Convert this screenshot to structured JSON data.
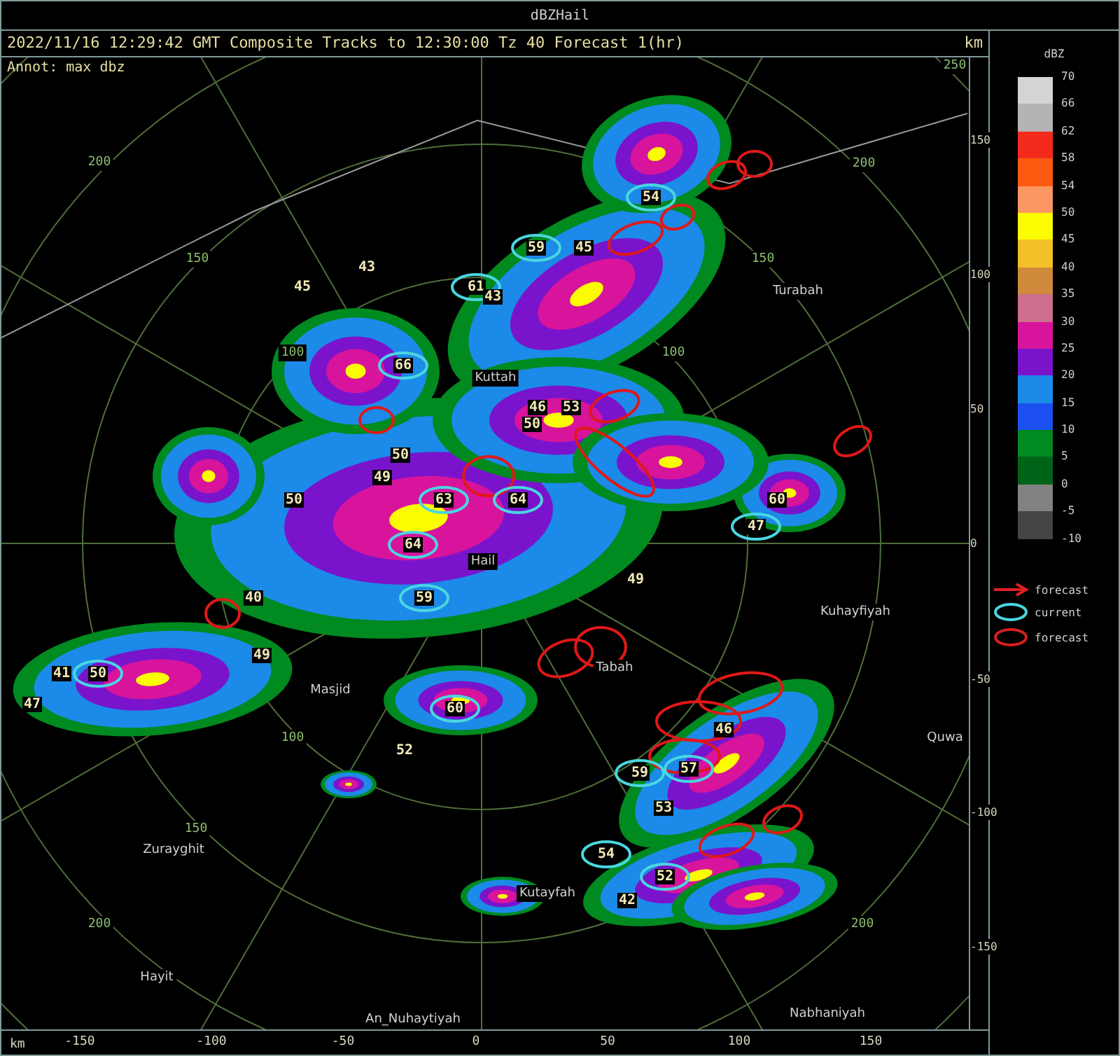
{
  "window": {
    "title": "dBZHail"
  },
  "header": {
    "caption": "2022/11/16 12:29:42 GMT Composite Tracks to 12:30:00 Tz 40 Forecast 1(hr)",
    "unit": "km"
  },
  "map": {
    "annotation": "Annot: max dbz",
    "places": [
      {
        "label": "Turabah"
      },
      {
        "label": "Kuttah"
      },
      {
        "label": "Hail"
      },
      {
        "label": "Kuhayfiyah"
      },
      {
        "label": "Tabah"
      },
      {
        "label": "Masjid"
      },
      {
        "label": "Quwa"
      },
      {
        "label": "Zurayghit"
      },
      {
        "label": "Kutayfah"
      },
      {
        "label": "Hayit"
      },
      {
        "label": "An_Nuhaytiyah"
      },
      {
        "label": "Nabhaniyah"
      }
    ],
    "ring_labels": [
      "200",
      "150",
      "100",
      "200",
      "150",
      "100",
      "250",
      "100",
      "150",
      "200",
      "200"
    ],
    "cells": [
      {
        "value": "54",
        "kind": "current"
      },
      {
        "value": "59",
        "kind": "current"
      },
      {
        "value": "45",
        "kind": "plain"
      },
      {
        "value": "43",
        "kind": "plain"
      },
      {
        "value": "45",
        "kind": "plain"
      },
      {
        "value": "61",
        "kind": "current"
      },
      {
        "value": "43",
        "kind": "plain"
      },
      {
        "value": "66",
        "kind": "current"
      },
      {
        "value": "46",
        "kind": "plain"
      },
      {
        "value": "53",
        "kind": "plain"
      },
      {
        "value": "50",
        "kind": "plain"
      },
      {
        "value": "50",
        "kind": "plain"
      },
      {
        "value": "49",
        "kind": "plain"
      },
      {
        "value": "50",
        "kind": "plain"
      },
      {
        "value": "63",
        "kind": "current"
      },
      {
        "value": "64",
        "kind": "current"
      },
      {
        "value": "60",
        "kind": "plain"
      },
      {
        "value": "47",
        "kind": "current"
      },
      {
        "value": "64",
        "kind": "current"
      },
      {
        "value": "49",
        "kind": "plain"
      },
      {
        "value": "40",
        "kind": "plain"
      },
      {
        "value": "59",
        "kind": "current"
      },
      {
        "value": "49",
        "kind": "plain"
      },
      {
        "value": "41",
        "kind": "plain"
      },
      {
        "value": "50",
        "kind": "current"
      },
      {
        "value": "47",
        "kind": "plain"
      },
      {
        "value": "60",
        "kind": "current"
      },
      {
        "value": "46",
        "kind": "plain"
      },
      {
        "value": "52",
        "kind": "plain"
      },
      {
        "value": "59",
        "kind": "current"
      },
      {
        "value": "57",
        "kind": "current"
      },
      {
        "value": "53",
        "kind": "plain"
      },
      {
        "value": "54",
        "kind": "current"
      },
      {
        "value": "52",
        "kind": "current"
      },
      {
        "value": "42",
        "kind": "plain"
      }
    ]
  },
  "y_axis": {
    "ticks": [
      "150",
      "100",
      "50",
      "0",
      "-50",
      "-100",
      "-150"
    ]
  },
  "x_axis": {
    "unit": "km",
    "ticks": [
      "-150",
      "-100",
      "-50",
      "0",
      "50",
      "100",
      "150"
    ]
  },
  "legend": {
    "title": "dBZ",
    "levels": [
      {
        "label": "70",
        "color": "#d4d4d4"
      },
      {
        "label": "66",
        "color": "#b4b4b4"
      },
      {
        "label": "62",
        "color": "#f42a1c"
      },
      {
        "label": "58",
        "color": "#fc5a10"
      },
      {
        "label": "54",
        "color": "#fc9662"
      },
      {
        "label": "50",
        "color": "#fcfc00"
      },
      {
        "label": "45",
        "color": "#f4c028"
      },
      {
        "label": "40",
        "color": "#d08a3c"
      },
      {
        "label": "35",
        "color": "#cc6e8c"
      },
      {
        "label": "30",
        "color": "#d8149c"
      },
      {
        "label": "25",
        "color": "#7a14cc"
      },
      {
        "label": "20",
        "color": "#1c8ae8"
      },
      {
        "label": "15",
        "color": "#1c50f0"
      },
      {
        "label": "10",
        "color": "#008a20"
      },
      {
        "label": "5",
        "color": "#006418"
      },
      {
        "label": "0",
        "color": "#828282"
      },
      {
        "label": "-5",
        "color": "#444444"
      },
      {
        "label": "-10"
      }
    ],
    "keys": [
      {
        "kind": "arrow",
        "label": "forecast"
      },
      {
        "kind": "current",
        "label": "current"
      },
      {
        "kind": "forecast",
        "label": "forecast"
      }
    ]
  }
}
